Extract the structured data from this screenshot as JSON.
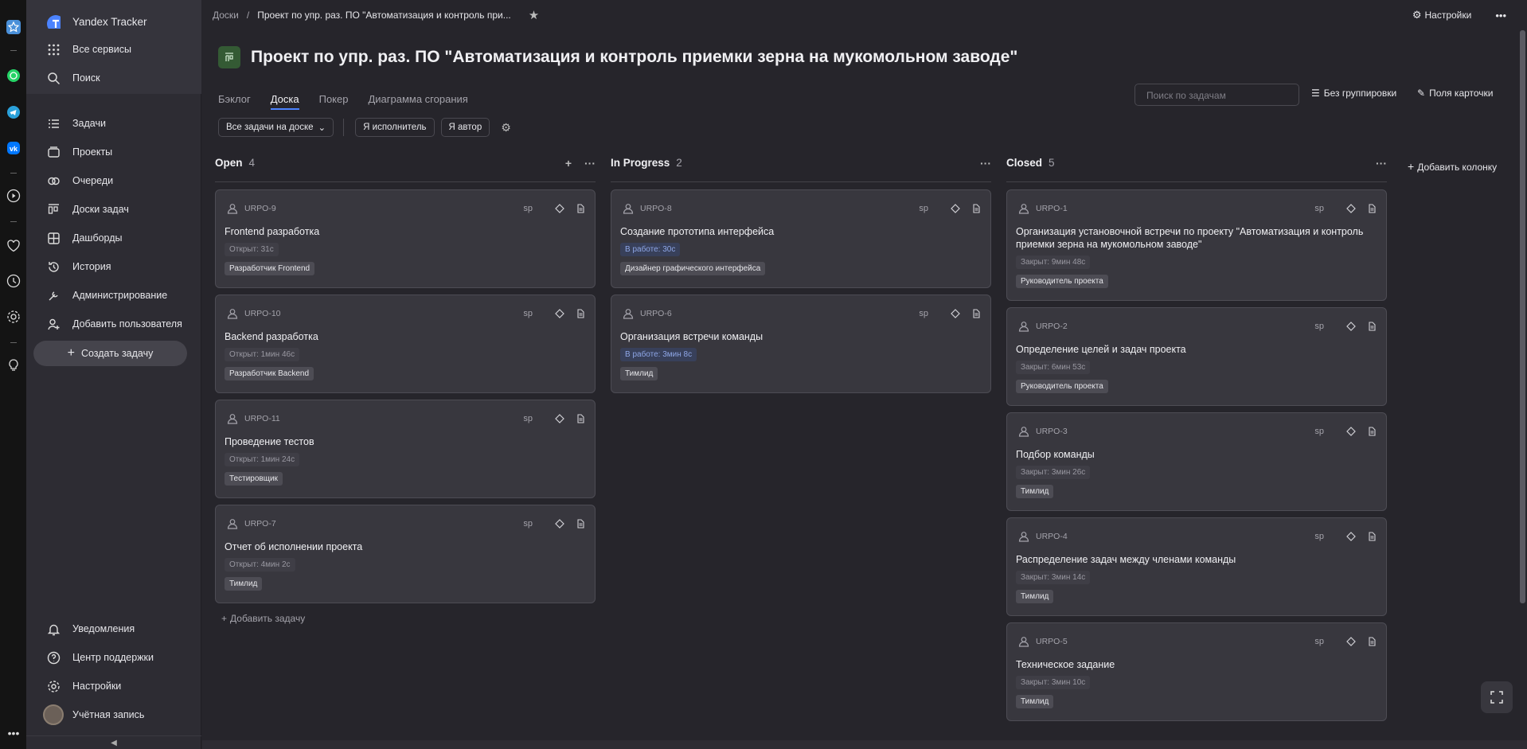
{
  "sidebar": {
    "app_name": "Yandex Tracker",
    "top_items": [
      {
        "label": "Все сервисы",
        "icon": "grid-icon"
      },
      {
        "label": "Поиск",
        "icon": "search-icon"
      }
    ],
    "items": [
      {
        "label": "Задачи",
        "icon": "list-icon"
      },
      {
        "label": "Проекты",
        "icon": "projects-icon"
      },
      {
        "label": "Очереди",
        "icon": "queues-icon"
      },
      {
        "label": "Доски задач",
        "icon": "board-icon"
      },
      {
        "label": "Дашборды",
        "icon": "dashboard-icon"
      },
      {
        "label": "История",
        "icon": "history-icon"
      },
      {
        "label": "Администрирование",
        "icon": "admin-icon"
      },
      {
        "label": "Добавить пользователя",
        "icon": "add-user-icon"
      }
    ],
    "create_label": "Создать задачу",
    "bottom_items": [
      {
        "label": "Уведомления",
        "icon": "bell-icon"
      },
      {
        "label": "Центр поддержки",
        "icon": "help-icon"
      },
      {
        "label": "Настройки",
        "icon": "gear-icon"
      },
      {
        "label": "Учётная запись",
        "icon": "avatar-icon"
      }
    ]
  },
  "topbar": {
    "breadcrumb_root": "Доски",
    "breadcrumb_current": "Проект по упр. раз. ПО \"Автоматизация и контроль при...",
    "settings_label": "Настройки"
  },
  "page": {
    "title": "Проект по упр. раз. ПО \"Автоматизация и контроль приемки зерна на мукомольном заводе\"",
    "tabs": [
      {
        "label": "Бэклог"
      },
      {
        "label": "Доска",
        "active": true
      },
      {
        "label": "Покер"
      },
      {
        "label": "Диаграмма сгорания"
      }
    ],
    "search_placeholder": "Поиск по задачам",
    "grouping_label": "Без группировки",
    "fields_label": "Поля карточки",
    "filters": {
      "scope": "Все задачи на доске",
      "assignee": "Я исполнитель",
      "author": "Я автор"
    }
  },
  "columns": [
    {
      "name": "Open",
      "count": "4",
      "cards": [
        {
          "key": "URPO-9",
          "title": "Frontend разработка",
          "status": "Открыт: 31с",
          "tag": "Разработчик Frontend"
        },
        {
          "key": "URPO-10",
          "title": "Backend разработка",
          "status": "Открыт: 1мин 46с",
          "tag": "Разработчик Backend"
        },
        {
          "key": "URPO-11",
          "title": "Проведение тестов",
          "status": "Открыт: 1мин 24с",
          "tag": "Тестировщик"
        },
        {
          "key": "URPO-7",
          "title": "Отчет об исполнении проекта",
          "status": "Открыт: 4мин 2с",
          "tag": "Тимлид"
        }
      ]
    },
    {
      "name": "In Progress",
      "count": "2",
      "cards": [
        {
          "key": "URPO-8",
          "title": "Создание прототипа интерфейса",
          "status": "В работе: 30с",
          "tag": "Дизайнер графического интерфейса"
        },
        {
          "key": "URPO-6",
          "title": "Организация встречи команды",
          "status": "В работе: 3мин 8с",
          "tag": "Тимлид"
        }
      ]
    },
    {
      "name": "Closed",
      "count": "5",
      "cards": [
        {
          "key": "URPO-1",
          "title": "Организация установочной встречи по проекту \"Автоматизация и контроль приемки зерна на мукомольном заводе\"",
          "status": "Закрыт: 9мин 48с",
          "tag": "Руководитель проекта"
        },
        {
          "key": "URPO-2",
          "title": "Определение целей и задач проекта",
          "status": "Закрыт: 6мин 53с",
          "tag": "Руководитель проекта"
        },
        {
          "key": "URPO-3",
          "title": "Подбор команды",
          "status": "Закрыт: 3мин 26с",
          "tag": "Тимлид"
        },
        {
          "key": "URPO-4",
          "title": "Распределение задач между членами команды",
          "status": "Закрыт: 3мин 14с",
          "tag": "Тимлид"
        },
        {
          "key": "URPO-5",
          "title": "Техническое задание",
          "status": "Закрыт: 3мин 10с",
          "tag": "Тимлид"
        }
      ]
    }
  ],
  "card_sp_label": "sp",
  "add_task_label": "Добавить задачу",
  "add_column_label": "Добавить колонку"
}
